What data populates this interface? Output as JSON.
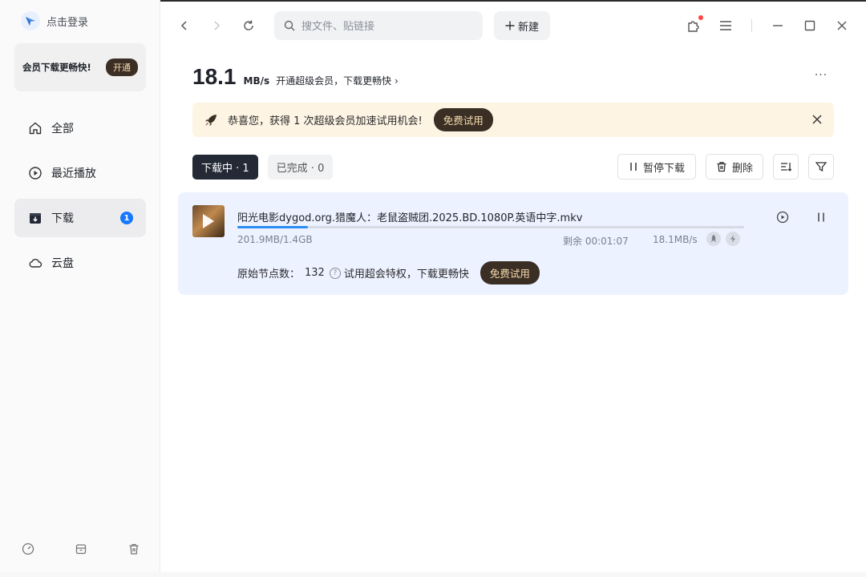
{
  "sidebar": {
    "login_label": "点击登录",
    "vip": {
      "text": "会员下载更畅快!",
      "button": "开通"
    },
    "items": [
      {
        "label": "全部",
        "icon": "home-icon"
      },
      {
        "label": "最近播放",
        "icon": "play-circle-icon"
      },
      {
        "label": "下载",
        "icon": "download-box-icon",
        "badge": "1",
        "active": true
      },
      {
        "label": "云盘",
        "icon": "cloud-icon"
      }
    ],
    "bottom_icons": [
      "speed-gauge-icon",
      "archive-icon",
      "trash-icon"
    ]
  },
  "toolbar": {
    "search_placeholder": "搜文件、贴链接",
    "new_label": "新建"
  },
  "header": {
    "speed_value": "18.1",
    "speed_unit": "MB/s",
    "promo": "开通超级会员，下载更畅快"
  },
  "banner": {
    "text": "恭喜您，获得 1 次超级会员加速试用机会!",
    "button": "免费试用"
  },
  "tabs": [
    {
      "label": "下载中 · 1",
      "active": true
    },
    {
      "label": "已完成 · 0",
      "active": false
    }
  ],
  "actions": {
    "pause_all": "暂停下载",
    "delete": "删除"
  },
  "download": {
    "filename": "阳光电影dygod.org.猎魔人：老鼠盗贼团.2025.BD.1080P.英语中字.mkv",
    "size": "201.9MB/1.4GB",
    "progress_fraction": 0.14,
    "remaining": "剩余 00:01:07",
    "speed": "18.1MB/s",
    "nodes_label": "原始节点数：",
    "nodes_count": "132",
    "trial_text": "试用超会特权，下载更畅快",
    "trial_button": "免费试用"
  },
  "colors": {
    "accent": "#1677ff",
    "vip_dark": "#3b2f25",
    "vip_gold": "#f7dcae",
    "card_bg": "#ecf2ff",
    "banner_bg": "#fdf4e4"
  }
}
